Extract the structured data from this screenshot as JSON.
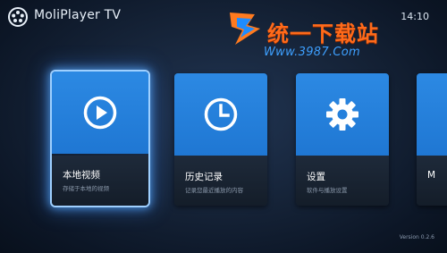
{
  "app": {
    "title": "MoliPlayer TV",
    "clock": "14:10",
    "version": "Version 0.2.6"
  },
  "watermark": {
    "title": "统一下载站",
    "url": "Www.3987.Com",
    "brand_color": "#ff6a1a"
  },
  "tiles": [
    {
      "label": "本地视频",
      "sub": "存储于本地的视频",
      "icon": "play-icon",
      "selected": true
    },
    {
      "label": "历史记录",
      "sub": "记录您最近播放的内容",
      "icon": "clock-icon",
      "selected": false
    },
    {
      "label": "设置",
      "sub": "软件与播放设置",
      "icon": "gear-icon",
      "selected": false
    },
    {
      "label": "M",
      "sub": "",
      "icon": "",
      "selected": false
    }
  ],
  "colors": {
    "tile_blue": "#2580dc",
    "focus_glow": "#9fd0ff"
  }
}
